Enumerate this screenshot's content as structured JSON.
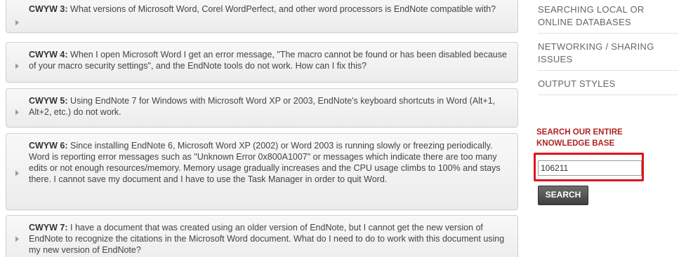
{
  "faq": {
    "items": [
      {
        "label": "CWYW 3:",
        "text": " What versions of Microsoft Word, Corel WordPerfect, and other word processors is EndNote compatible with?"
      },
      {
        "label": "CWYW 4:",
        "text": " When I open Microsoft Word I get an error message, \"The macro cannot be found or has been disabled because of your macro security settings\", and the EndNote tools do not work. How can I fix this?"
      },
      {
        "label": "CWYW 5:",
        "text": " Using EndNote 7 for Windows with Microsoft Word XP or 2003, EndNote's keyboard shortcuts in Word (Alt+1, Alt+2, etc.) do not work."
      },
      {
        "label": "CWYW 6:",
        "text": " Since installing EndNote 6, Microsoft Word XP (2002) or Word 2003 is running slowly or freezing periodically. Word is reporting error messages such as \"Unknown Error 0x800A1007\" or messages which indicate there are too many edits or not enough resources/memory. Memory usage gradually increases and the CPU usage climbs to 100% and stays there. I cannot save my document and I have to use the Task Manager in order to quit Word."
      },
      {
        "label": "CWYW 7:",
        "text": " I have a document that was created using an older version of EndNote, but I cannot get the new version of EndNote to recognize the citations in the Microsoft Word document. What do I need to do to work with this document using my new version of EndNote?"
      }
    ]
  },
  "sidebar": {
    "nav": [
      {
        "label": "SEARCHING LOCAL OR ONLINE DATABASES"
      },
      {
        "label": "NETWORKING / SHARING ISSUES"
      },
      {
        "label": "OUTPUT STYLES"
      }
    ],
    "search_title": "SEARCH OUR ENTIRE KNOWLEDGE BASE",
    "search_value": "106211",
    "search_button": "SEARCH"
  },
  "colors": {
    "accent_red": "#b22222",
    "highlight_red": "#e0141b"
  }
}
